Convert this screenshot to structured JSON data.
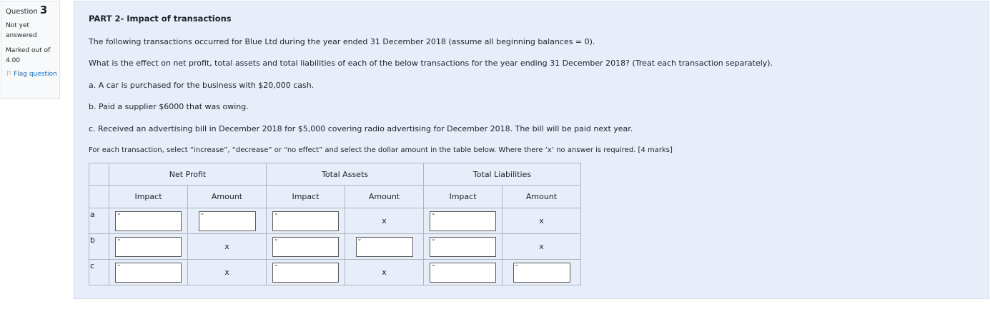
{
  "question_info": {
    "label": "Question",
    "number": "3",
    "state": "Not yet answered",
    "grade": "Marked out of 4.00",
    "flag_label": "Flag question"
  },
  "content": {
    "title": "PART 2- Impact of transactions",
    "intro": "The following transactions occurred for Blue Ltd during the year ended 31 December 2018 (assume all beginning balances = 0).",
    "question": "What is the effect on net profit, total assets and total liabilities of each of the below transactions for the year ending 31 December 2018? (Treat each transaction separately).",
    "item_a": "a. A car is purchased for the business with $20,000 cash.",
    "item_b": "b. Paid a supplier $6000 that was owing.",
    "item_c": "c. Received an advertising bill in December 2018 for $5,000 covering radio advertising for December 2018. The bill will be paid next year.",
    "instruction": "For each transaction, select “increase”, “decrease” or “no effect” and select the dollar amount in the table below. Where there ‘x’ no answer is required. [4 marks]"
  },
  "table": {
    "groups": [
      "Net Profit",
      "Total Assets",
      "Total Liabilities"
    ],
    "subheaders": [
      "Impact",
      "Amount",
      "Impact",
      "Amount",
      "Impact",
      "Amount"
    ],
    "rows": [
      {
        "label": "a",
        "cells": [
          "select",
          "select",
          "select",
          "x",
          "select",
          "x"
        ]
      },
      {
        "label": "b",
        "cells": [
          "select",
          "x",
          "select",
          "select",
          "select",
          "x"
        ]
      },
      {
        "label": "c",
        "cells": [
          "select",
          "x",
          "select",
          "x",
          "select",
          "select"
        ]
      }
    ],
    "select_value": "",
    "chevron": "chevron-down-icon"
  }
}
